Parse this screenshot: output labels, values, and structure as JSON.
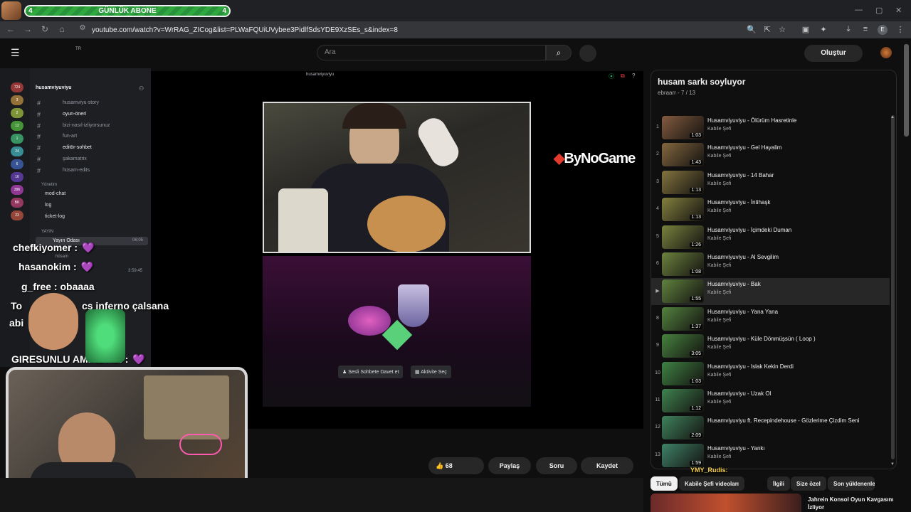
{
  "overlay": {
    "label": "GÜNLÜK ABONE",
    "left_count": "4",
    "right_count": "4",
    "progress": 1.0
  },
  "browser": {
    "url": "youtube.com/watch?v=WrRAG_ZICog&list=PLWaFQUiUVybee3PidlfSdsYDE9XzSEs_s&index=8",
    "profile_initial": "E"
  },
  "header": {
    "locale": "TR",
    "search_placeholder": "Ara",
    "create_label": "Oluştur"
  },
  "discord": {
    "server_name": "husamviyuviyu",
    "channels": [
      {
        "prefix": "#",
        "name": "husamviyu-story"
      },
      {
        "prefix": "#",
        "name": "oyun-öneri",
        "bright": true
      },
      {
        "prefix": "#",
        "name": "bizi-nasıl-izliyorsunuz"
      },
      {
        "prefix": "#",
        "name": "fun-art"
      },
      {
        "prefix": "#",
        "name": "editör-sohbet",
        "bright": true
      },
      {
        "prefix": "#",
        "name": "şakamatrix"
      },
      {
        "prefix": "#",
        "name": "hüsam-edits"
      }
    ],
    "mod_category": "Yönetim",
    "mod_channels": [
      "mod-chat",
      "log",
      "ticket-log"
    ],
    "voice_category": "YAYIN",
    "voice_channel": "Yayın Odası",
    "voice_time": "06:05",
    "voice_user": "hüsam",
    "voice_time2": "3:59:45",
    "server_badges": [
      "724",
      "3",
      "2",
      "12",
      "1",
      "24",
      "6",
      "16",
      "396",
      "BK",
      "23"
    ],
    "stream_user": "husamviyuviyu",
    "activity_buttons": [
      "Sesli Sohbete Davet et",
      "Aktivite Seç"
    ]
  },
  "sponsor": "ByNoGame",
  "chat_overlay": [
    {
      "user": "chefkiyomer",
      "msg": ":",
      "emote": "💜"
    },
    {
      "user": "hasanokim",
      "msg": ":",
      "emote": "💜"
    },
    {
      "user": "g_free",
      "msg": ": obaaaa"
    },
    {
      "user": "To",
      "msg": "cs inferno çalsana"
    },
    {
      "user": "abi",
      "msg": ""
    },
    {
      "user": "GIRESUNLU",
      "msg": "AMINDADI :",
      "emote": "💜"
    }
  ],
  "actions": {
    "likes": "68",
    "share": "Paylaş",
    "ask": "Soru",
    "save": "Kaydet"
  },
  "playlist": {
    "title": "husam sarkı soyluyor",
    "owner": "ebraarr",
    "position": "7 / 13",
    "items": [
      {
        "num": "1",
        "title": "Husamviyuviyu - Ölürüm Hasretinle",
        "channel": "Kabile Şefi",
        "duration": "1:03"
      },
      {
        "num": "2",
        "title": "Husamviyuviyu - Gel Hayalim",
        "channel": "Kabile Şefi",
        "duration": "1:43"
      },
      {
        "num": "3",
        "title": "Husamviyuviyu - 14 Bahar",
        "channel": "Kabile Şefi",
        "duration": "1:13"
      },
      {
        "num": "4",
        "title": "Husamviyuviyu - İntihaşk",
        "channel": "Kabile Şefi",
        "duration": "1:13"
      },
      {
        "num": "5",
        "title": "Husamviyuviyu - İçimdeki Duman",
        "channel": "Kabile Şefi",
        "duration": "1:26"
      },
      {
        "num": "6",
        "title": "Husamviyuviyu - Al Sevgilim",
        "channel": "Kabile Şefi",
        "duration": "1:08"
      },
      {
        "num": "▶",
        "title": "Husamviyuviyu - Bak",
        "channel": "Kabile Şefi",
        "duration": "1:55",
        "active": true
      },
      {
        "num": "8",
        "title": "Husamviyuviyu - Yana Yana",
        "channel": "Kabile Şefi",
        "duration": "1:37"
      },
      {
        "num": "9",
        "title": "Husamviyuviyu - Küle Dönmüşsün ( Loop )",
        "channel": "Kabile Şefi",
        "duration": "3:05"
      },
      {
        "num": "10",
        "title": "Husamviyuviyu - Islak Kekin Derdi",
        "channel": "Kabile Şefi",
        "duration": "1:03"
      },
      {
        "num": "11",
        "title": "Husamviyuviyu - Uzak Ol",
        "channel": "Kabile Şefi",
        "duration": "1:12"
      },
      {
        "num": "12",
        "title": "Husamviyuviyu ft. Recepindehouse - Gözlerime Çizdim Seni",
        "channel": "Kabile Şefi",
        "duration": "2:09"
      },
      {
        "num": "13",
        "title": "Husamviyuviyu - Yankı",
        "channel": "Kabile Şefi",
        "duration": "1:59"
      }
    ]
  },
  "chips": [
    "Tümü",
    "Kabile Şefi videoları",
    "İlgili",
    "Size özel",
    "Son yüklenenler"
  ],
  "chip_overlay_user": "YMY_Rudis:",
  "rec_video": {
    "title": "Jahrein Konsol Oyun Kavgasını İzliyor"
  }
}
